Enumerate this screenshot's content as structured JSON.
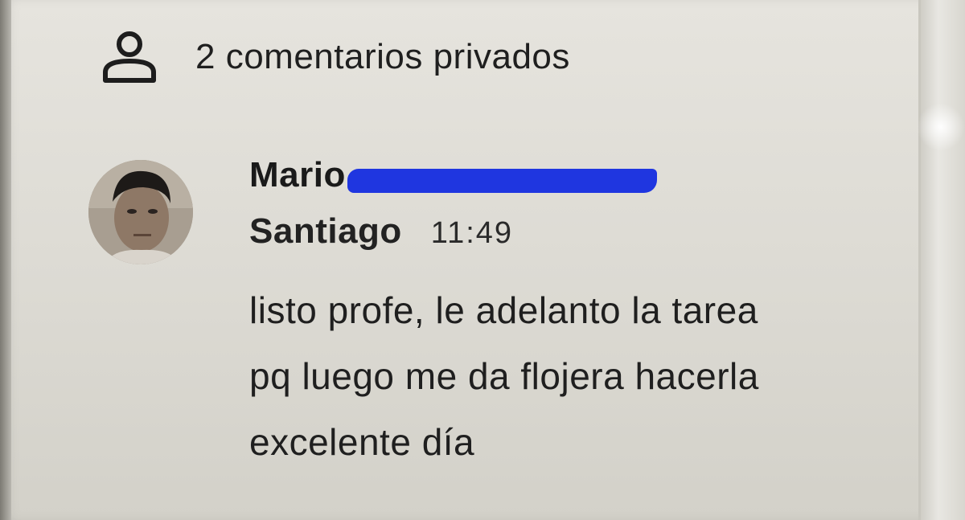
{
  "header": {
    "icon": "person-outline-icon",
    "title": "2 comentarios privados"
  },
  "comment": {
    "avatar": "avatar-photo",
    "author_first": "Mario",
    "author_redacted": true,
    "redaction_color": "#1f36e0",
    "author_last": "Santiago",
    "time": "11:49",
    "lines": [
      "listo profe, le adelanto la tarea",
      "pq luego me da flojera hacerla",
      "excelente día"
    ]
  }
}
